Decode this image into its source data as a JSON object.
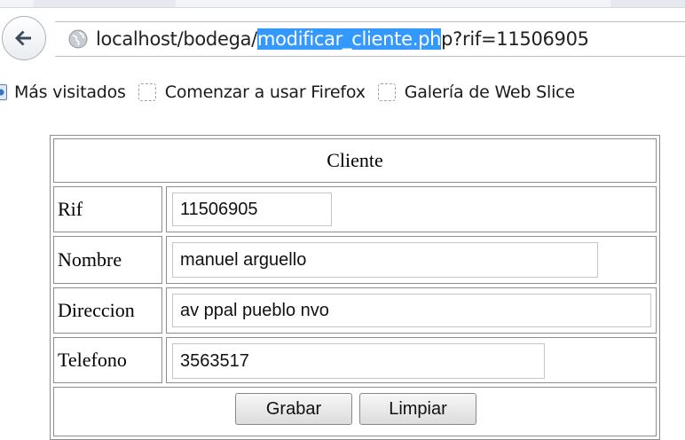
{
  "browser": {
    "url_prefix": "localhost/bodega/",
    "url_highlight": "modificar_cliente.ph",
    "url_suffix": "p?rif=11506905",
    "bookmarks": [
      "Más visitados",
      "Comenzar a usar Firefox",
      "Galería de Web Slice"
    ]
  },
  "form": {
    "title": "Cliente",
    "fields": [
      {
        "label": "Rif",
        "value": "11506905"
      },
      {
        "label": "Nombre",
        "value": "manuel arguello"
      },
      {
        "label": "Direccion",
        "value": "av ppal pueblo nvo"
      },
      {
        "label": "Telefono",
        "value": "3563517"
      }
    ],
    "buttons": {
      "save": "Grabar",
      "clear": "Limpiar"
    }
  }
}
